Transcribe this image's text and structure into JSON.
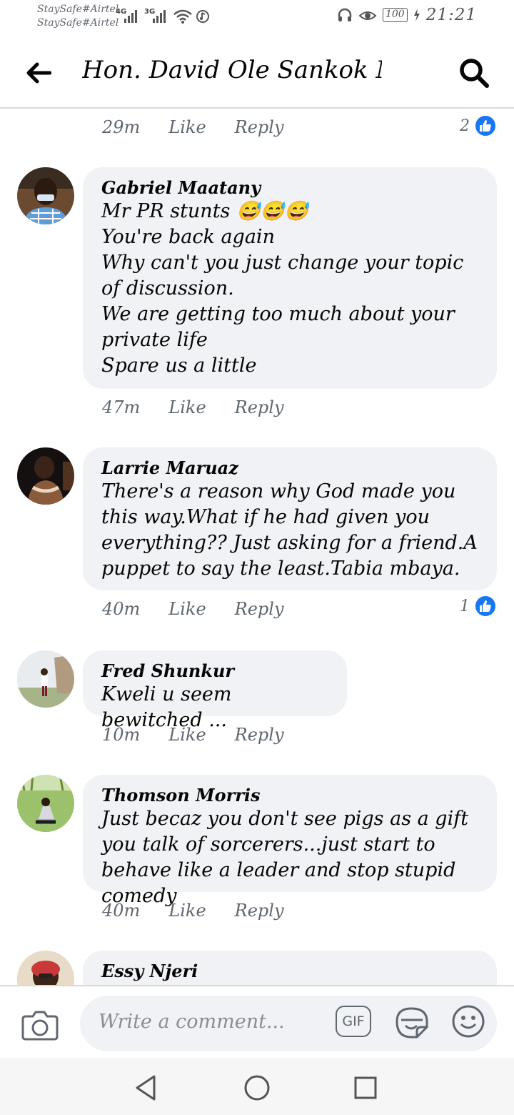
{
  "status_bar": {
    "carrier_1": "StaySafe#Airtel",
    "carrier_2": "StaySafe#Airtel",
    "network_1": "4G",
    "network_2": "3G",
    "battery": "100",
    "time": "21:21"
  },
  "header": {
    "title": "Hon. David Ole Sankok MP"
  },
  "previous_comment": {
    "time": "29m",
    "like_label": "Like",
    "reply_label": "Reply",
    "like_count": "2"
  },
  "comments": [
    {
      "author": "Gabriel Maatany",
      "text": "Mr PR stunts 😅😅😅\nYou're back again\nWhy can't you just change your topic of discussion.\nWe are getting too much about your private life\nSpare us a little",
      "time": "47m",
      "like_label": "Like",
      "reply_label": "Reply"
    },
    {
      "author": "Larrie Maruaz",
      "text": "There's a reason why God made you this way.What if he had given you everything?? Just asking for a friend.A puppet to say the least.Tabia mbaya.",
      "time": "40m",
      "like_label": "Like",
      "reply_label": "Reply",
      "like_count": "1"
    },
    {
      "author": "Fred Shunkur",
      "text": "Kweli u seem bewitched ...",
      "time": "10m",
      "like_label": "Like",
      "reply_label": "Reply"
    },
    {
      "author": "Thomson Morris",
      "text": "Just becaz you don't see pigs as a gift you talk of sorcerers...just start to behave like a leader and stop stupid comedy",
      "time": "40m",
      "like_label": "Like",
      "reply_label": "Reply"
    },
    {
      "author": "Essy Njeri",
      "text": ""
    }
  ],
  "composer": {
    "placeholder": "Write a comment...",
    "gif_label": "GIF"
  },
  "icons": {
    "back": "arrow-left-icon",
    "search": "search-icon",
    "camera": "camera-icon",
    "sticker": "sticker-icon",
    "emoji": "emoji-icon",
    "like_badge": "thumbs-up-icon"
  },
  "colors": {
    "accent": "#1877f2",
    "bubble": "#f0f2f5",
    "meta_text": "#606770"
  }
}
